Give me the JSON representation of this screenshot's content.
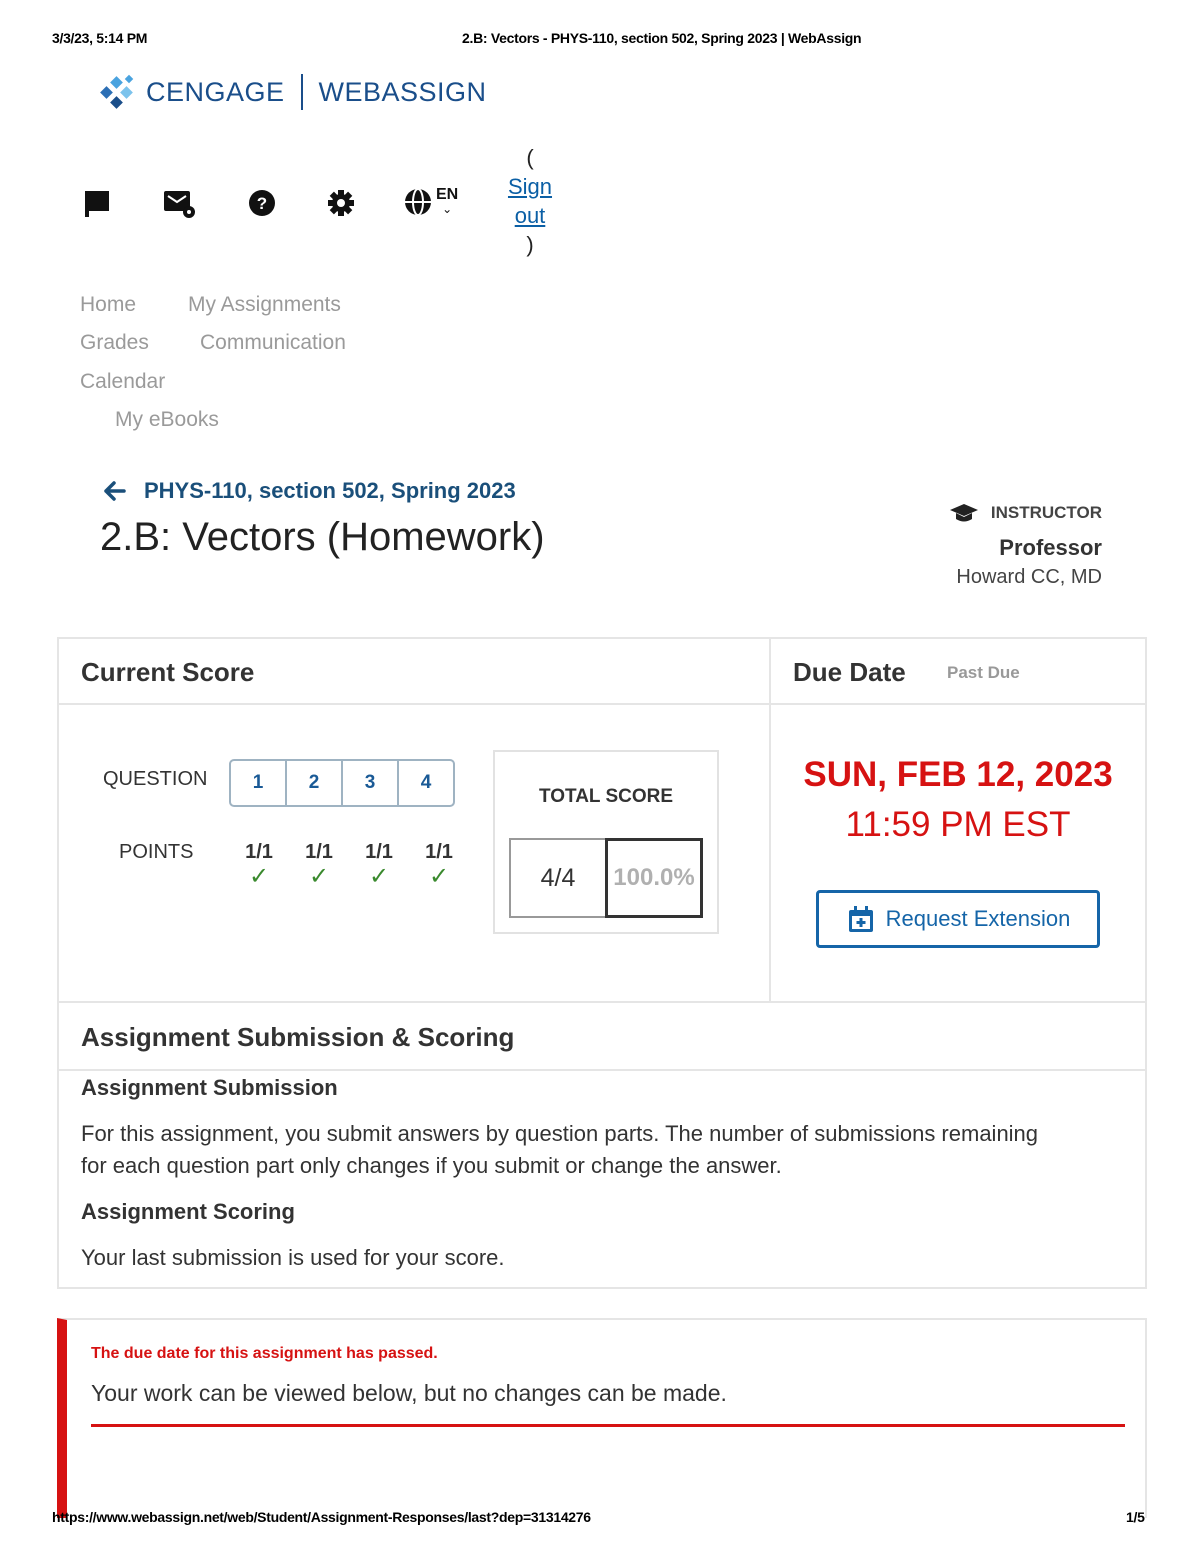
{
  "print_header": {
    "datetime": "3/3/23, 5:14 PM",
    "title": "2.B: Vectors - PHYS-110, section 502, Spring 2023 | WebAssign"
  },
  "logo": {
    "brand": "CENGAGE",
    "product": "WEBASSIGN"
  },
  "toolbar": {
    "icons": [
      "flag-icon",
      "message-icon",
      "help-icon",
      "settings-icon",
      "globe-icon"
    ],
    "language": "EN",
    "signout_open": "(",
    "signout_label_1": "Sign",
    "signout_label_2": "out",
    "signout_close": ")"
  },
  "nav": {
    "home": "Home",
    "my_assignments": "My Assignments",
    "grades": "Grades",
    "communication": "Communication",
    "calendar": "Calendar",
    "my_ebooks": "My eBooks"
  },
  "breadcrumb": {
    "course": "PHYS-110, section 502, Spring 2023"
  },
  "page_title": "2.B: Vectors (Homework)",
  "instructor": {
    "label": "INSTRUCTOR",
    "name": "Professor",
    "org": "Howard CC, MD"
  },
  "score_panel": {
    "heading": "Current Score",
    "question_label": "QUESTION",
    "points_label": "POINTS",
    "questions": [
      "1",
      "2",
      "3",
      "4"
    ],
    "points": [
      "1/1",
      "1/1",
      "1/1",
      "1/1"
    ],
    "total_label": "TOTAL SCORE",
    "total_points": "4/4",
    "total_percent": "100.0%"
  },
  "due_panel": {
    "heading": "Due Date",
    "status": "Past Due",
    "date": "SUN, FEB 12, 2023",
    "time": "11:59 PM EST",
    "extension_button": "Request Extension"
  },
  "submission_panel": {
    "heading": "Assignment Submission & Scoring",
    "submission_title": "Assignment Submission",
    "submission_text_1": "For this assignment, you submit answers by question parts. The number of submissions remaining",
    "submission_text_2": "for each question part only changes if you submit or change the answer.",
    "scoring_title": "Assignment Scoring",
    "scoring_text": "Your last submission is used for your score."
  },
  "alert": {
    "title": "The due date for this assignment has passed.",
    "text": "Your work can be viewed below, but no changes can be made."
  },
  "print_footer": {
    "url": "https://www.webassign.net/web/Student/Assignment-Responses/last?dep=31314276",
    "page": "1/5"
  },
  "colors": {
    "brand_blue": "#1a4e8a",
    "due_red": "#d61212",
    "check_green": "#3a8a2e",
    "button_blue": "#1565a8"
  }
}
